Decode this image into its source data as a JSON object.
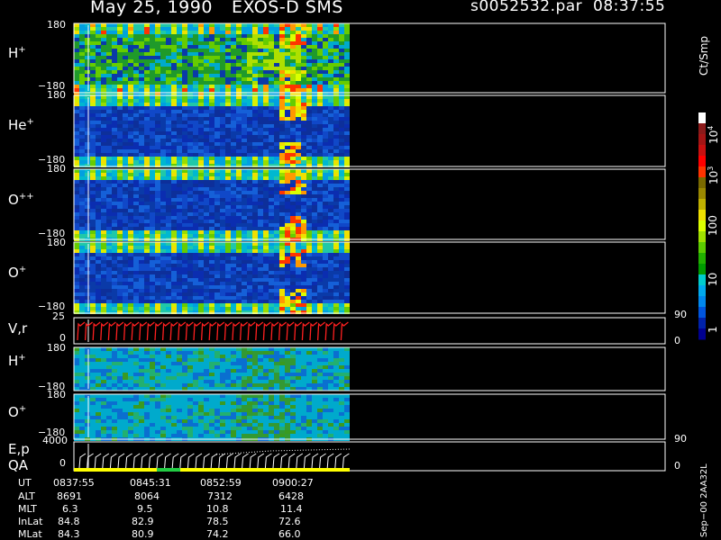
{
  "header": {
    "date": "May 25, 1990",
    "instrument": "EXOS-D SMS",
    "file": "s0052532.par",
    "time": "08:37:55"
  },
  "panels": [
    {
      "label": "H",
      "sup": "+",
      "top_tick": "180",
      "bottom_tick": "−180"
    },
    {
      "label": "He",
      "sup": "+",
      "top_tick": "180",
      "bottom_tick": "−180"
    },
    {
      "label": "O",
      "sup": "++",
      "top_tick": "180",
      "bottom_tick": "−180"
    },
    {
      "label": "O",
      "sup": "+",
      "top_tick": "180",
      "bottom_tick": "−180"
    },
    {
      "label": "V,r",
      "sup": "",
      "top_tick": "25",
      "bottom_tick": "0",
      "right_top": "90",
      "right_bottom": "0"
    },
    {
      "label": "H",
      "sup": "+",
      "top_tick": "180",
      "bottom_tick": "−180"
    },
    {
      "label": "O",
      "sup": "+",
      "top_tick": "180",
      "bottom_tick": "−180"
    },
    {
      "label": "E,p",
      "sup": "",
      "label2": "QA",
      "top_tick": "4000",
      "bottom_tick": "0",
      "right_top": "90",
      "right_bottom": "0"
    }
  ],
  "colorbar": {
    "unit": "Ct/Smp",
    "labels": [
      "10",
      "10",
      "100",
      "10",
      "1"
    ],
    "exponents": [
      "4",
      "3",
      "",
      "",
      ""
    ],
    "colors": [
      "#ffffff",
      "#8b1a1a",
      "#a41515",
      "#c81010",
      "#ff0000",
      "#ff3300",
      "#7a6a00",
      "#9a8800",
      "#c0b000",
      "#f0e000",
      "#dcff00",
      "#a0e000",
      "#5ccc00",
      "#22b000",
      "#009a00",
      "#00cccc",
      "#00aaee",
      "#0088ee",
      "#0055dd",
      "#0022aa",
      "#000090"
    ]
  },
  "footer": {
    "rows": [
      {
        "label": "UT",
        "values": [
          "0837:55",
          "0845:31",
          "0852:59",
          "0900:27"
        ]
      },
      {
        "label": "ALT",
        "values": [
          "8691",
          "8064",
          "7312",
          "6428"
        ]
      },
      {
        "label": "MLT",
        "values": [
          "6.3",
          "9.5",
          "10.8",
          "11.4"
        ]
      },
      {
        "label": "InLat",
        "values": [
          "84.8",
          "82.9",
          "78.5",
          "72.6"
        ]
      },
      {
        "label": "MLat",
        "values": [
          "84.3",
          "80.9",
          "74.2",
          "66.0"
        ]
      }
    ],
    "side_label": "Sep−00  2AA32L"
  },
  "qa_colors": [
    "#ffff00",
    "#22cc44"
  ]
}
